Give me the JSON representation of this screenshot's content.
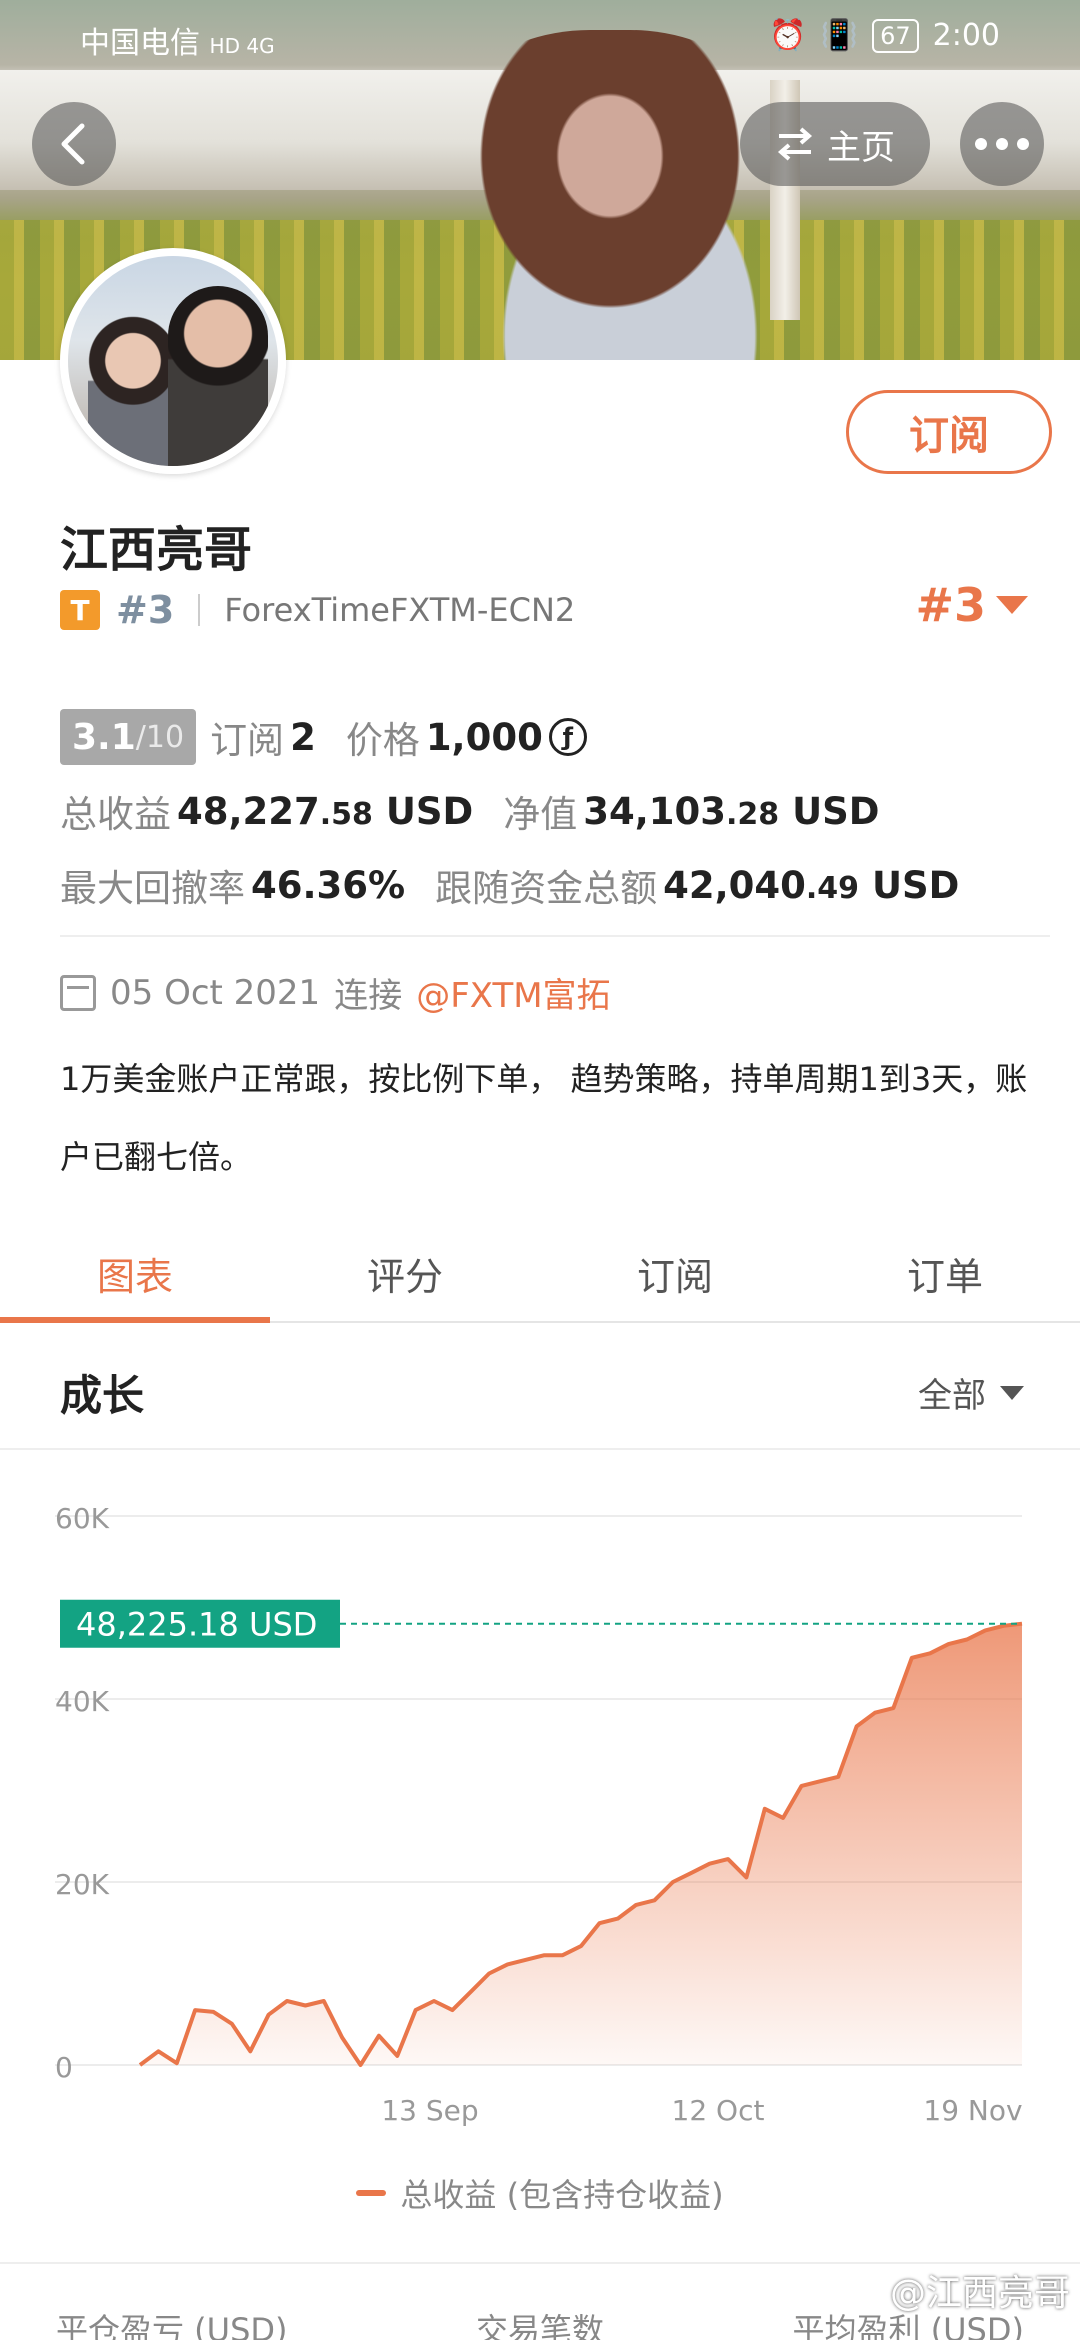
{
  "status_bar": {
    "carrier": "中国电信",
    "network": "HD 4G",
    "battery": "67",
    "time": "2:00"
  },
  "header": {
    "back_icon": "chevron-left-icon",
    "home_label": "主页",
    "more_icon": "more-dots-icon"
  },
  "profile": {
    "name": "江西亮哥",
    "level_badge": "T",
    "rank": "#3",
    "broker": "ForexTimeFXTM-ECN2",
    "subscribe_label": "订阅",
    "rank_right": "#3"
  },
  "stats": {
    "score": "3.1",
    "score_den": "/10",
    "subscribe_label": "订阅",
    "subscribe_count": "2",
    "price_label": "价格",
    "price_value": "1,000",
    "price_icon": "ƒ",
    "total_profit_label": "总收益",
    "total_profit_int": "48,227",
    "total_profit_dec": ".58",
    "total_profit_unit": "USD",
    "equity_label": "净值",
    "equity_int": "34,103",
    "equity_dec": ".28",
    "equity_unit": "USD",
    "drawdown_label": "最大回撤率",
    "drawdown_value": "46.36%",
    "follow_label": "跟随资金总额",
    "follow_int": "42,040",
    "follow_dec": ".49",
    "follow_unit": "USD"
  },
  "connection": {
    "date": "05 Oct 2021",
    "text": "连接",
    "link": "@FXTM富拓"
  },
  "description": "1万美金账户正常跟，按比例下单， 趋势策略，持单周期1到3天，账户已翻七倍。",
  "tabs": [
    {
      "label": "图表",
      "active": true
    },
    {
      "label": "评分",
      "active": false
    },
    {
      "label": "订阅",
      "active": false
    },
    {
      "label": "订单",
      "active": false
    }
  ],
  "growth": {
    "title": "成长",
    "filter": "全部"
  },
  "chart_data": {
    "type": "area",
    "y_ticks": [
      "60K",
      "40K",
      "20K",
      "0"
    ],
    "ylim": [
      0,
      60000
    ],
    "x_ticks": [
      "13 Sep",
      "12 Oct",
      "19 Nov"
    ],
    "current_label": "48,225.18 USD",
    "current_value": 48225.18,
    "series": [
      {
        "name": "总收益 (包含持仓收益)",
        "values": [
          0,
          1500,
          200,
          6000,
          5800,
          4500,
          1500,
          5500,
          7000,
          6500,
          7000,
          3000,
          0,
          3200,
          1000,
          6000,
          7000,
          6000,
          8000,
          10000,
          11000,
          11500,
          12000,
          12000,
          13000,
          15500,
          16000,
          17500,
          18000,
          20000,
          21000,
          22000,
          22500,
          20500,
          28000,
          27000,
          30500,
          31000,
          31500,
          37000,
          38500,
          39000,
          44500,
          45000,
          46000,
          46500,
          47500,
          48000,
          48225.18
        ]
      }
    ],
    "color": "#e9764a",
    "label_bg": "#13a383"
  },
  "legend": {
    "label": "总收益 (包含持仓收益)"
  },
  "bottom": {
    "col1": "平仓盈亏 (USD)",
    "col2": "交易笔数",
    "col3": "平均盈利 (USD)"
  },
  "watermark": "@江西亮哥"
}
